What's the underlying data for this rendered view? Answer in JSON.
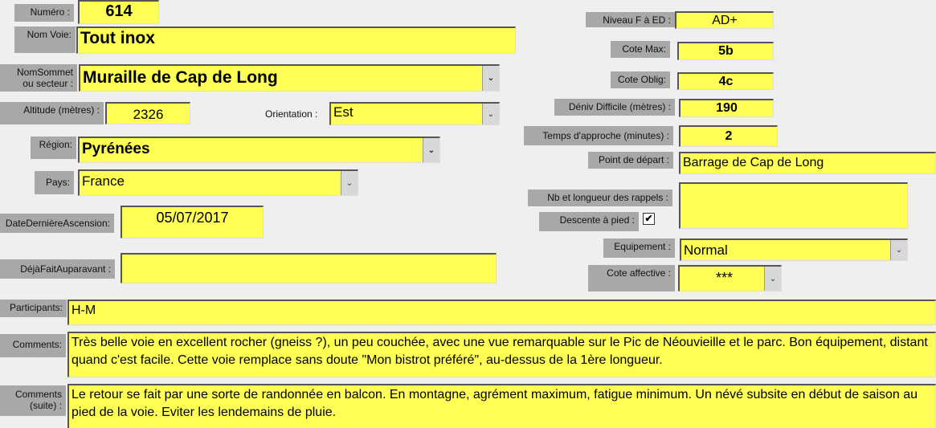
{
  "left": {
    "numero": {
      "label": "Numéro :",
      "value": "614"
    },
    "nom_voie": {
      "label": "Nom Voie:",
      "value": "Tout inox"
    },
    "nom_sommet": {
      "label_line1": "NomSommet",
      "label_line2": "ou secteur :",
      "value": "Muraille de Cap de Long"
    },
    "altitude": {
      "label": "Altitude (mètres) :",
      "value": "2326"
    },
    "orientation": {
      "label": "Orientation :",
      "value": "Est"
    },
    "region": {
      "label": "Région:",
      "value": "Pyrénées"
    },
    "pays": {
      "label": "Pays:",
      "value": "France"
    },
    "date": {
      "label": "DateDernièreAscension:",
      "value": "05/07/2017"
    },
    "deja_fait": {
      "label": "DéjàFaitAuparavant :",
      "value": ""
    }
  },
  "right": {
    "niveau": {
      "label": "Niveau F à ED :",
      "value": "AD+"
    },
    "cote_max": {
      "label": "Cote Max:",
      "value": "5b"
    },
    "cote_oblig": {
      "label": "Cote Oblig:",
      "value": "4c"
    },
    "deniv": {
      "label": "Déniv Difficile (mètres) :",
      "value": "190"
    },
    "temps": {
      "label": "Temps d'approche (minutes) :",
      "value": "2"
    },
    "point_depart": {
      "label": "Point de départ :",
      "value": "Barrage de Cap de Long"
    },
    "rappels": {
      "label": "Nb et longueur des rappels :",
      "value": ""
    },
    "descente": {
      "label": "Descente à pied :",
      "checked": true,
      "check_glyph": "✔"
    },
    "equipement": {
      "label": "Equipement :",
      "value": "Normal"
    },
    "cote_affective": {
      "label": "Cote affective :",
      "value": "***"
    }
  },
  "bottom": {
    "participants": {
      "label": "Participants:",
      "value": "H-M"
    },
    "comments": {
      "label": "Comments:",
      "value": "Très belle voie en excellent rocher (gneiss ?), un peu couchée, avec une vue remarquable sur le Pic de Néouvieille et le parc. Bon équipement, distant quand c'est facile. Cette voie remplace sans doute \"Mon bistrot préféré\", au-dessus de la 1ère longueur."
    },
    "comments_suite": {
      "label_line1": "Comments",
      "label_line2": "(suite) :",
      "value": "Le retour se fait par une sorte de randonnée en balcon. En montagne, agrément maximum, fatigue minimum. Un névé subsite en début de saison au pied de la voie. Eviter les lendemains de pluie."
    }
  },
  "icons": {
    "dropdown": "chevron-down-icon",
    "dropdown_glyph": "⌄"
  },
  "colors": {
    "field": "#ffff55",
    "label": "#a8a8a8",
    "background": "#efefef"
  }
}
